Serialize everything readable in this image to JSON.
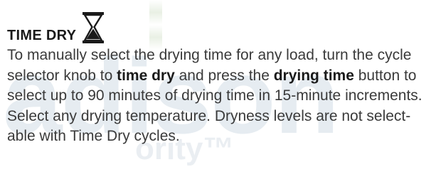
{
  "section": {
    "title": "TIME DRY",
    "icon": "hourglass-icon",
    "paragraph": {
      "part1": "To manually select the drying time for any load, turn the cycle selector knob to ",
      "bold1": "time dry",
      "part2": " and press the ",
      "bold2": "drying time",
      "part3": " button to select up to 90 minutes of drying time in 15-minute increments. Select any drying temperature. Dryness levels are not select-able with Time Dry cycles."
    }
  },
  "watermark": {
    "word": "adison",
    "sub": "ority™"
  },
  "colors": {
    "heading": "#1a1a1a",
    "body": "#3a3a3a",
    "watermark": "#e6ecf1"
  }
}
